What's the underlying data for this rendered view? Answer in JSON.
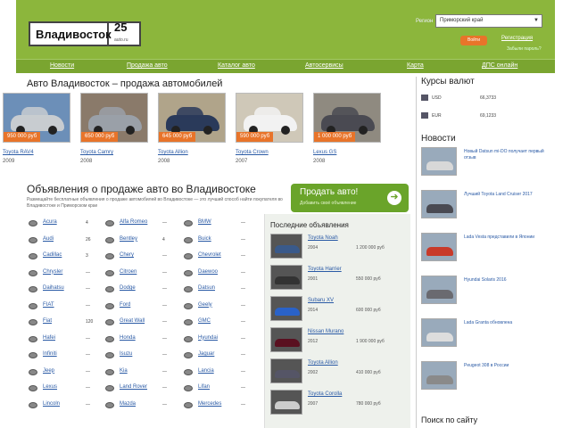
{
  "header": {
    "logo_city": "Владивосток",
    "logo_number": "25",
    "logo_small": "auto.ru",
    "region_label": "Регион",
    "region_value": "Приморский край",
    "login": "Войти",
    "register": "Регистрация",
    "forgot": "Забыли пароль?"
  },
  "nav": [
    "Новости",
    "Продажа авто",
    "Каталог авто",
    "Автосервисы",
    "Карта",
    "ДПС онлайн"
  ],
  "main": {
    "section_title": "Авто Владивосток – продажа автомобилей",
    "featured": [
      {
        "name": "Toyota RAV4",
        "year": "2009",
        "price": "950 000 руб",
        "color": "#c8ccd0",
        "bg": "#6c8fb8"
      },
      {
        "name": "Toyota Camry",
        "year": "2008",
        "price": "650 000 руб",
        "color": "#9aa0a8",
        "bg": "#8a7a6a"
      },
      {
        "name": "Toyota Allion",
        "year": "2008",
        "price": "645 000 руб",
        "color": "#2a3a5a",
        "bg": "#b0a48a"
      },
      {
        "name": "Toyota Crown",
        "year": "2007",
        "price": "590 000 руб",
        "color": "#f2f2f2",
        "bg": "#cfc8b8"
      },
      {
        "name": "Lexus GS",
        "year": "2008",
        "price": "1 000 000 руб",
        "color": "#4a4a52",
        "bg": "#8f8a80"
      }
    ],
    "ads_title": "Объявления о продаже авто во Владивостоке",
    "ads_sub": "Размещайте бесплатные объявления о продаже автомобилей во Владивостоке — это лучший способ найти покупателя во Владивостоке и Приморском крае",
    "sell_button": "Продать авто!",
    "sell_sub": "Добавить своё объявление",
    "brands": [
      [
        "Acura",
        "4",
        "Alfa Romeo",
        "—",
        "BMW",
        "—"
      ],
      [
        "Audi",
        "26",
        "Bentley",
        "4",
        "Buick",
        "—"
      ],
      [
        "Cadillac",
        "3",
        "Chery",
        "—",
        "Chevrolet",
        "—"
      ],
      [
        "Chrysler",
        "—",
        "Citroen",
        "—",
        "Daewoo",
        "—"
      ],
      [
        "Daihatsu",
        "—",
        "Dodge",
        "—",
        "Datsun",
        "—"
      ],
      [
        "FIAT",
        "—",
        "Ford",
        "—",
        "Geely",
        "—"
      ],
      [
        "Fiat",
        "120",
        "Great Wall",
        "—",
        "GMC",
        "—"
      ],
      [
        "Hafei",
        "—",
        "Honda",
        "—",
        "Hyundai",
        "—"
      ],
      [
        "Infiniti",
        "—",
        "Isuzu",
        "—",
        "Jaguar",
        "—"
      ],
      [
        "Jeep",
        "—",
        "Kia",
        "—",
        "Lancia",
        "—"
      ],
      [
        "Lexus",
        "—",
        "Land Rover",
        "—",
        "Lifan",
        "—"
      ],
      [
        "Lincoln",
        "—",
        "Mazda",
        "—",
        "Mercedes",
        "—"
      ]
    ],
    "latest_title": "Последние объявления",
    "latest": [
      {
        "name": "Toyota Noah",
        "year": "2004",
        "price": "1 200 000 руб",
        "color": "#3a5a8a"
      },
      {
        "name": "Toyota Harrier",
        "year": "2001",
        "price": "550 000 руб",
        "color": "#333"
      },
      {
        "name": "Subaru XV",
        "year": "2014",
        "price": "600 000 руб",
        "color": "#2a62c8"
      },
      {
        "name": "Nissan Murano",
        "year": "2012",
        "price": "1 900 000 руб",
        "color": "#5a1020"
      },
      {
        "name": "Toyota Allion",
        "year": "2002",
        "price": "410 000 руб",
        "color": "#556"
      },
      {
        "name": "Toyota Corolla",
        "year": "2007",
        "price": "780 000 руб",
        "color": "#ccc"
      }
    ]
  },
  "right": {
    "rates_title": "Курсы валют",
    "rates": [
      {
        "code": "USD",
        "value": "66,3733"
      },
      {
        "code": "EUR",
        "value": "69,1233"
      }
    ],
    "news_title": "Новости",
    "news": [
      "Новый Datsun mi-DO получает первый отзыв",
      "Лучший Toyota Land Cruiser 2017",
      "Lada Vesta представили в Японии",
      "Hyundai Solaris 2016",
      "Lada Granta обновлена",
      "Peugeot 308 в России"
    ],
    "search_title": "Поиск по сайту"
  },
  "colors": {
    "header_green": "#8cb63c",
    "nav_green": "#7aa530",
    "accent_orange": "#e8742a",
    "link_blue": "#2a5aa5"
  }
}
